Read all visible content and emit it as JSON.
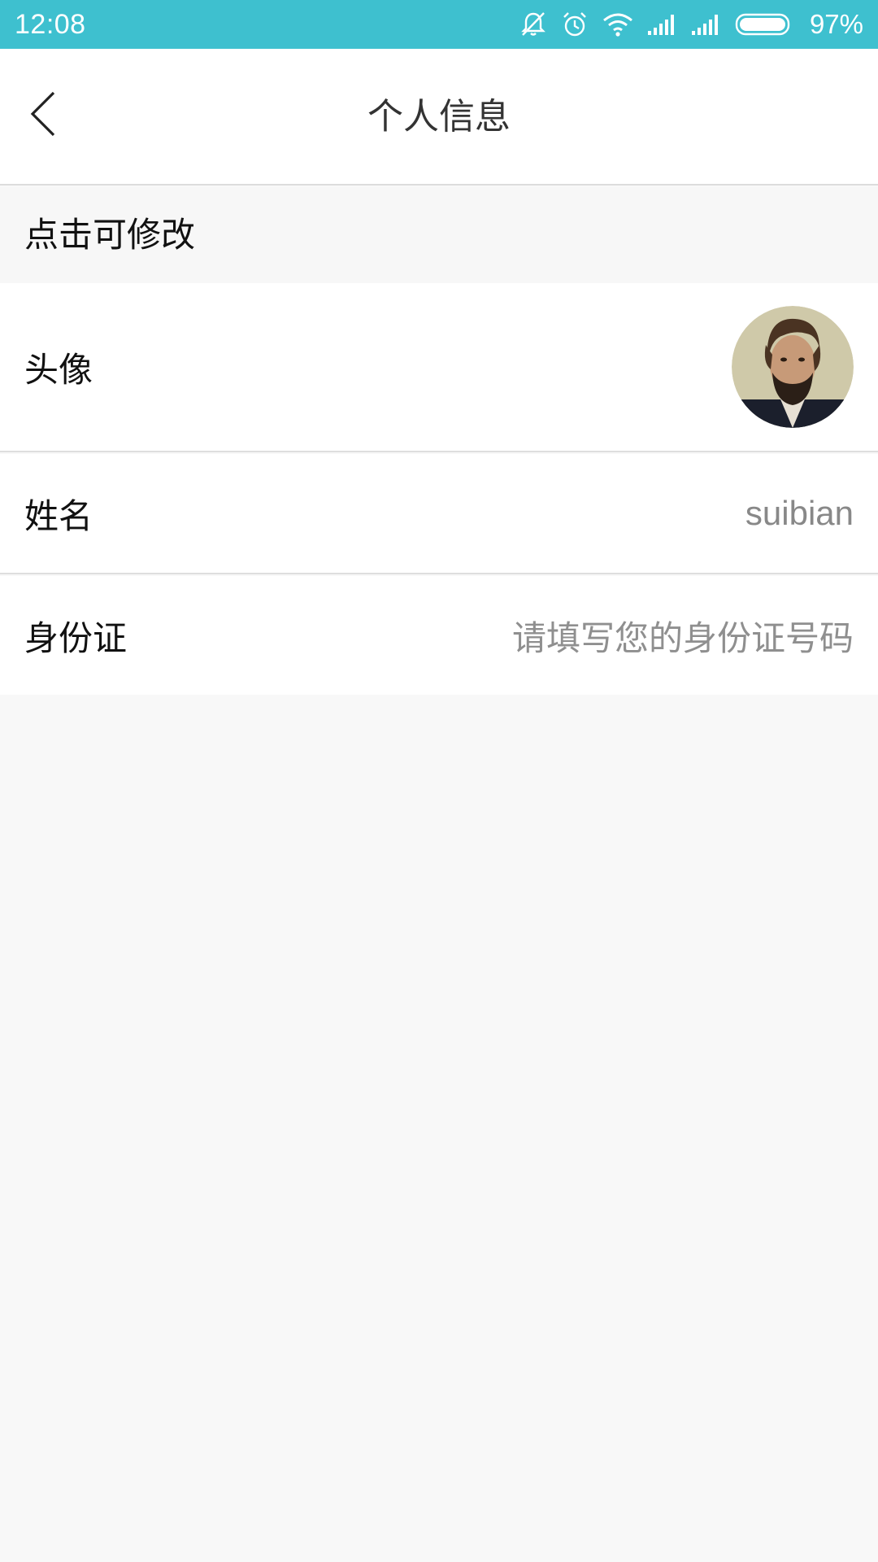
{
  "status_bar": {
    "time": "12:08",
    "battery_percent": "97%",
    "icons": [
      "mute-icon",
      "alarm-icon",
      "wifi-icon",
      "signal-icon",
      "signal-icon",
      "battery-icon"
    ],
    "background_color": "#3ec0cf"
  },
  "header": {
    "title": "个人信息",
    "back_icon": "back-arrow-icon"
  },
  "hint": {
    "text": "点击可修改"
  },
  "rows": {
    "avatar": {
      "label": "头像"
    },
    "name": {
      "label": "姓名",
      "value": "suibian"
    },
    "id_card": {
      "label": "身份证",
      "placeholder": "请填写您的身份证号码"
    }
  }
}
